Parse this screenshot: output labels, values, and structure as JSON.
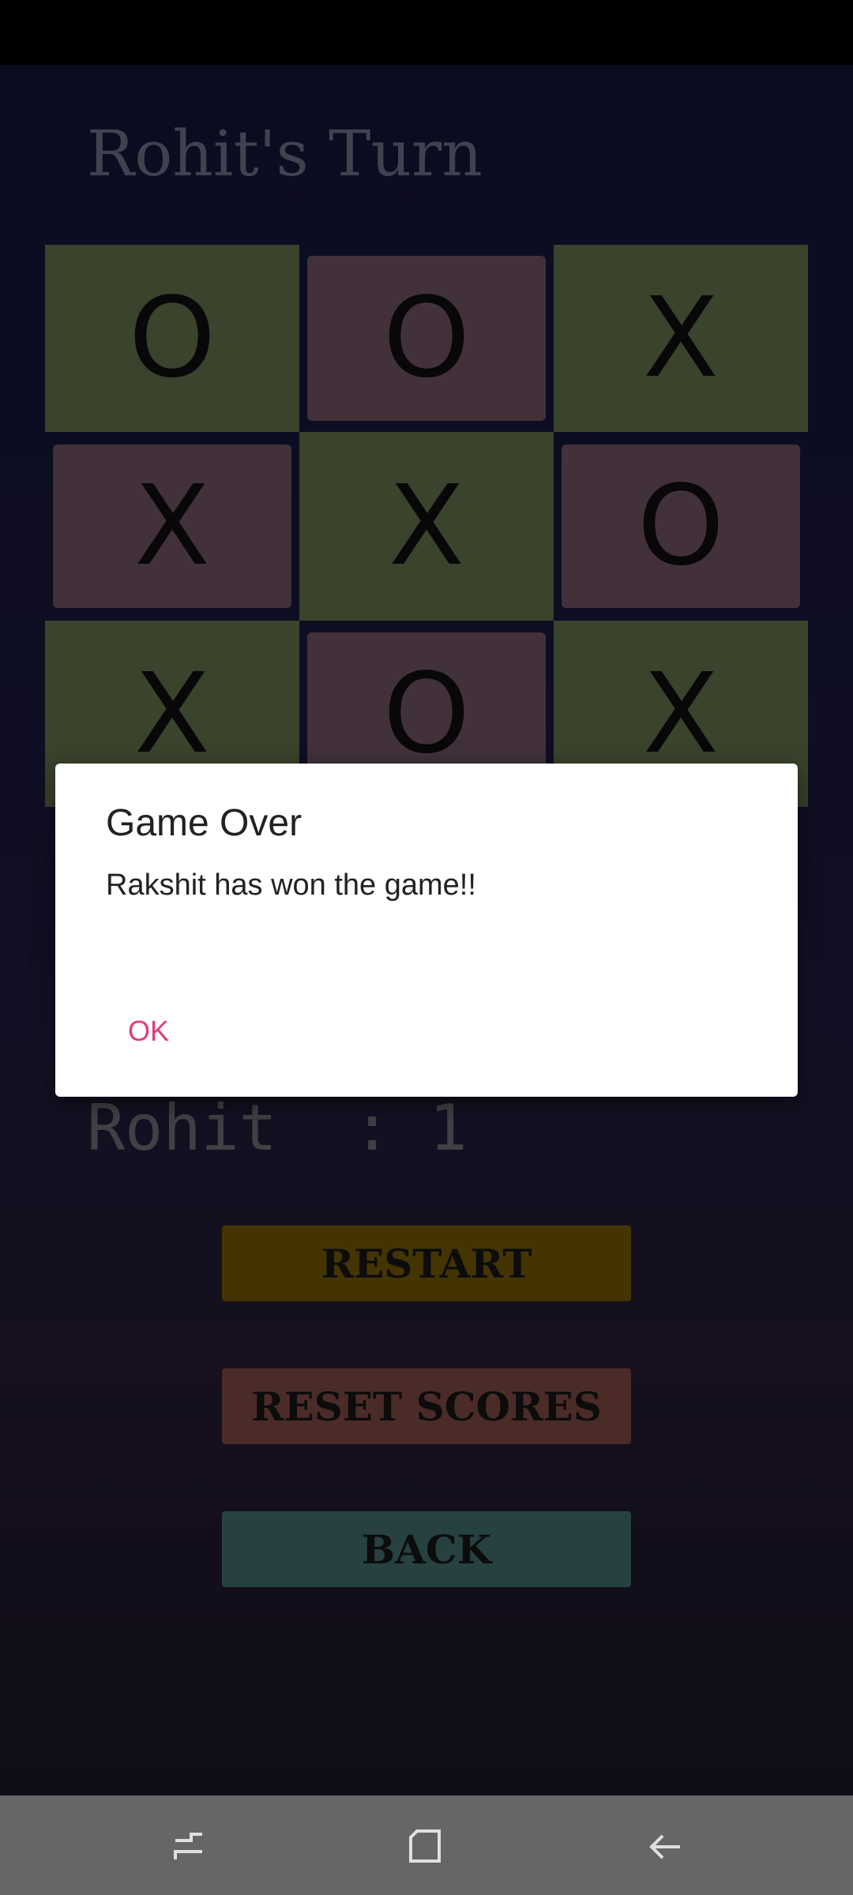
{
  "header": {
    "turn_title": "Rohit's Turn"
  },
  "board": {
    "cells": [
      "O",
      "O",
      "X",
      "X",
      "X",
      "O",
      "X",
      "O",
      "X"
    ]
  },
  "scores": {
    "rohit_line": "Rohit  : 1"
  },
  "buttons": {
    "restart": "RESTART",
    "reset_scores": "RESET SCORES",
    "back": "BACK"
  },
  "dialog": {
    "title": "Game Over",
    "message": "Rakshit has won the game!!",
    "ok": "OK"
  },
  "colors": {
    "green_cell": "#5e6c47",
    "pink_cell": "#6b5060",
    "restart": "#6e5504",
    "reset": "#7a4641",
    "back": "#3f6a6a",
    "ok_accent": "#e03c7d"
  },
  "nav": {
    "icons": [
      "recent-apps-icon",
      "home-icon",
      "back-arrow-icon"
    ]
  }
}
